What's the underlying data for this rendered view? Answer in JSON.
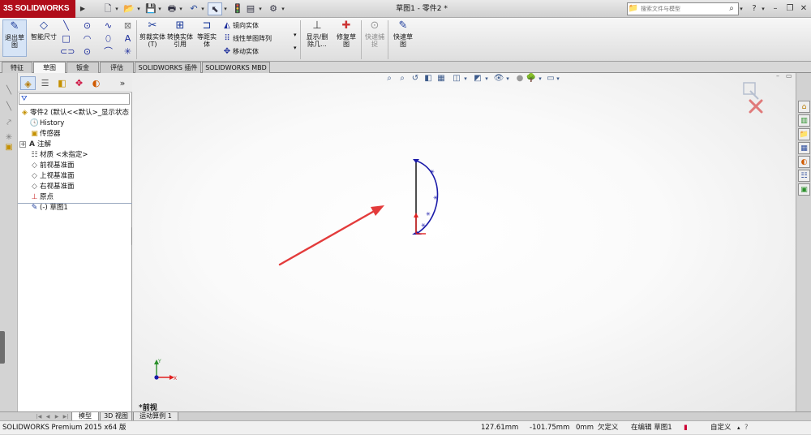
{
  "titlebar": {
    "app_name": "SOLIDWORKS",
    "logo_mark": "3S",
    "document_title": "草图1 - 零件2 *",
    "search_placeholder": "搜索文件与模型",
    "help_label": "?"
  },
  "ribbon": {
    "exit_sketch": "退出草图",
    "smart_dimension": "智能尺寸",
    "trim_entities": "剪裁实体(T)",
    "convert_entities": "转换实体引用",
    "offset_entities": "等距实体",
    "mirror_entities": "镜向实体",
    "linear_pattern": "线性草图阵列",
    "move_entities": "移动实体",
    "display_delete_relations": "显示/删除几...",
    "repair_sketch": "修复草图",
    "quick_snaps": "快速捕捉",
    "rapid_sketch": "快速草图"
  },
  "tabs": [
    "特征",
    "草图",
    "钣金",
    "评估",
    "SOLIDWORKS 插件",
    "SOLIDWORKS MBD"
  ],
  "active_tab": "草图",
  "feature_tree": {
    "root": "零件2 (默认<<默认>_显示状态",
    "items": [
      {
        "label": "History",
        "icon": "history-icon"
      },
      {
        "label": "传感器",
        "icon": "sensor-icon"
      },
      {
        "label": "注解",
        "icon": "annotation-icon"
      },
      {
        "label": "材质 <未指定>",
        "icon": "material-icon"
      },
      {
        "label": "前视基准面",
        "icon": "plane-icon"
      },
      {
        "label": "上视基准面",
        "icon": "plane-icon"
      },
      {
        "label": "右视基准面",
        "icon": "plane-icon"
      },
      {
        "label": "原点",
        "icon": "origin-icon"
      },
      {
        "label": "(-) 草图1",
        "icon": "sketch-icon"
      }
    ]
  },
  "viewport": {
    "view_name": "*前视",
    "triad_x": "X",
    "triad_y": "Y"
  },
  "bottom_tabs": [
    "模型",
    "3D 视图",
    "运动算例 1"
  ],
  "status": {
    "product": "SOLIDWORKS Premium 2015 x64 版",
    "x_coord": "127.61mm",
    "y_coord": "-101.75mm",
    "z_coord": "0mm",
    "constraint": "欠定义",
    "editing": "在编辑 草图1",
    "units": "自定义"
  },
  "colors": {
    "logo_red": "#b00d1a",
    "sketch_blue": "#1a1aa8",
    "arrow_red": "#e33b3b",
    "status_bar": "#f0f0f0"
  }
}
